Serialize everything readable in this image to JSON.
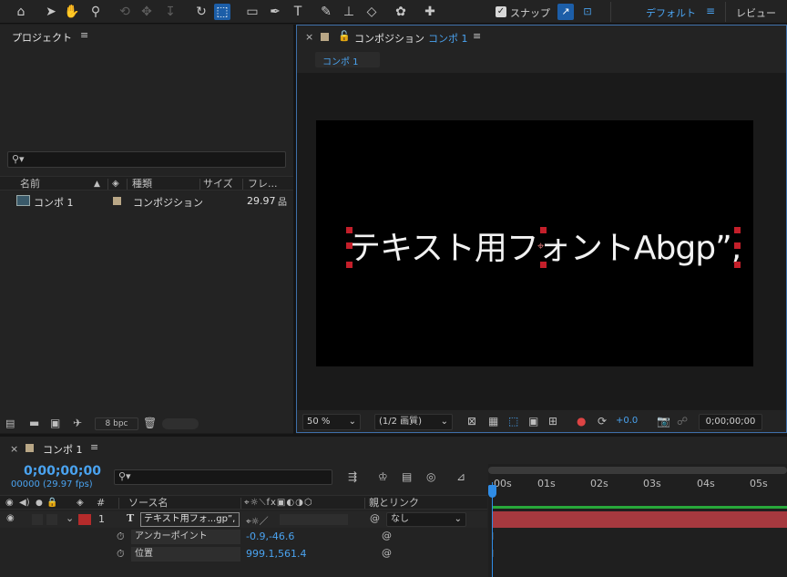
{
  "toolbar": {
    "snap_label": "スナップ",
    "workspace_default": "デフォルト",
    "workspace_review": "レビュー"
  },
  "project": {
    "title": "プロジェクト",
    "search_placeholder": "",
    "columns": {
      "name": "名前",
      "type": "種類",
      "size": "サイズ",
      "fps": "フレ..."
    },
    "items": [
      {
        "name": "コンポ 1",
        "type": "コンポジション",
        "fps": "29.97"
      }
    ],
    "bpc_label": "8 bpc"
  },
  "composition": {
    "panel_label": "コンポジション",
    "comp_name": "コンポ 1",
    "tab_label": "コンポ 1",
    "text_layer": "テキスト用フォントAbgp”,",
    "zoom": "50 %",
    "resolution": "(1/2 画質)",
    "exposure": "+0.0",
    "timecode": "0;00;00;00"
  },
  "timeline": {
    "comp_tab": "コンポ 1",
    "timecode": "0;00;00;00",
    "frame_info": "00000 (29.97 fps)",
    "columns": {
      "hash": "#",
      "source_name": "ソース名",
      "parent": "親とリンク"
    },
    "ruler_labels": [
      "00s",
      "01s",
      "02s",
      "03s",
      "04s",
      "05s"
    ],
    "layer": {
      "number": "1",
      "name": "テキスト用フォ...gp”,",
      "parent": "なし"
    },
    "properties": [
      {
        "name": "アンカーポイント",
        "value": "-0.9,-46.6"
      },
      {
        "name": "位置",
        "value": "999.1,561.4"
      }
    ],
    "colors": {
      "layer_label": "#b52b2b",
      "bar": "#a6393f",
      "accent": "#2f8ce6",
      "work_area": "#28a83a"
    }
  }
}
